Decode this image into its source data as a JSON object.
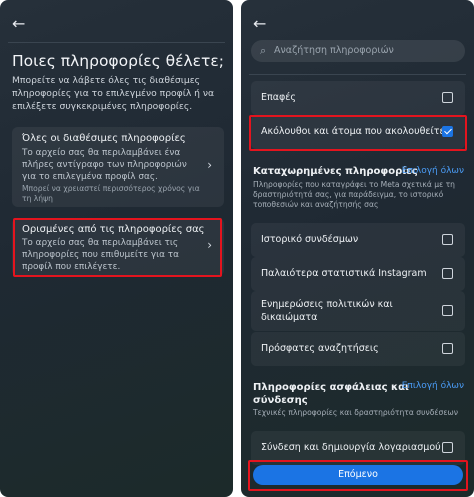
{
  "left_screen": {
    "back_label": "←",
    "title": "Ποιες πληροφορίες θέλετε;",
    "intro": "Μπορείτε να λάβετε όλες τις διαθέσιμες πληροφορίες για το επιλεγμένο προφίλ ή να επιλέξετε συγκεκριμένες πληροφορίες.",
    "options": [
      {
        "title": "Όλες οι διαθέσιμες πληροφορίες",
        "description": "Το αρχείο σας θα περιλαμβάνει ένα πλήρες αντίγραφο των πληροφοριών για το επιλεγμένα προφίλ σας.",
        "note": "Μπορεί να χρειαστεί περισσότερος χρόνος για τη λήψη",
        "chevron": "›"
      },
      {
        "title": "Ορισμένες από τις πληροφορίες σας",
        "description": "Το αρχείο σας θα περιλαμβάνει τις πληροφορίες που επιθυμείτε για τα προφίλ που επιλέγετε.",
        "chevron": "›"
      }
    ]
  },
  "right_screen": {
    "back_label": "←",
    "search_icon": "⌕",
    "search_placeholder": "Αναζήτηση πληροφοριών",
    "top_rows": [
      {
        "label": "Επαφές",
        "checked": false
      },
      {
        "label": "Ακόλουθοι και άτομα που ακολουθείτε",
        "checked": true
      }
    ],
    "section_logged": {
      "title": "Καταχωρημένες πληροφορίες",
      "select_all": "Επιλογή όλων",
      "description": "Πληροφορίες που καταγράφει το Meta σχετικά με τη δραστηριότητά σας, για παράδειγμα, το ιστορικό τοποθεσιών και αναζήτησής σας",
      "rows": [
        {
          "label": "Ιστορικό συνδέσμων",
          "checked": false
        },
        {
          "label": "Παλαιότερα στατιστικά Instagram",
          "checked": false
        },
        {
          "label": "Ενημερώσεις πολιτικών και δικαιώματα",
          "checked": false
        },
        {
          "label": "Πρόσφατες αναζητήσεις",
          "checked": false
        }
      ]
    },
    "section_security": {
      "title": "Πληροφορίες ασφάλειας και σύνδεσης",
      "select_all": "Επιλογή όλων",
      "description": "Τεχνικές πληροφορίες και δραστηριότητα συνδέσεων",
      "rows": [
        {
          "label": "Σύνδεση και δημιουργία λογαριασμού",
          "checked": false
        }
      ]
    },
    "next_button": "Επόμενο"
  }
}
